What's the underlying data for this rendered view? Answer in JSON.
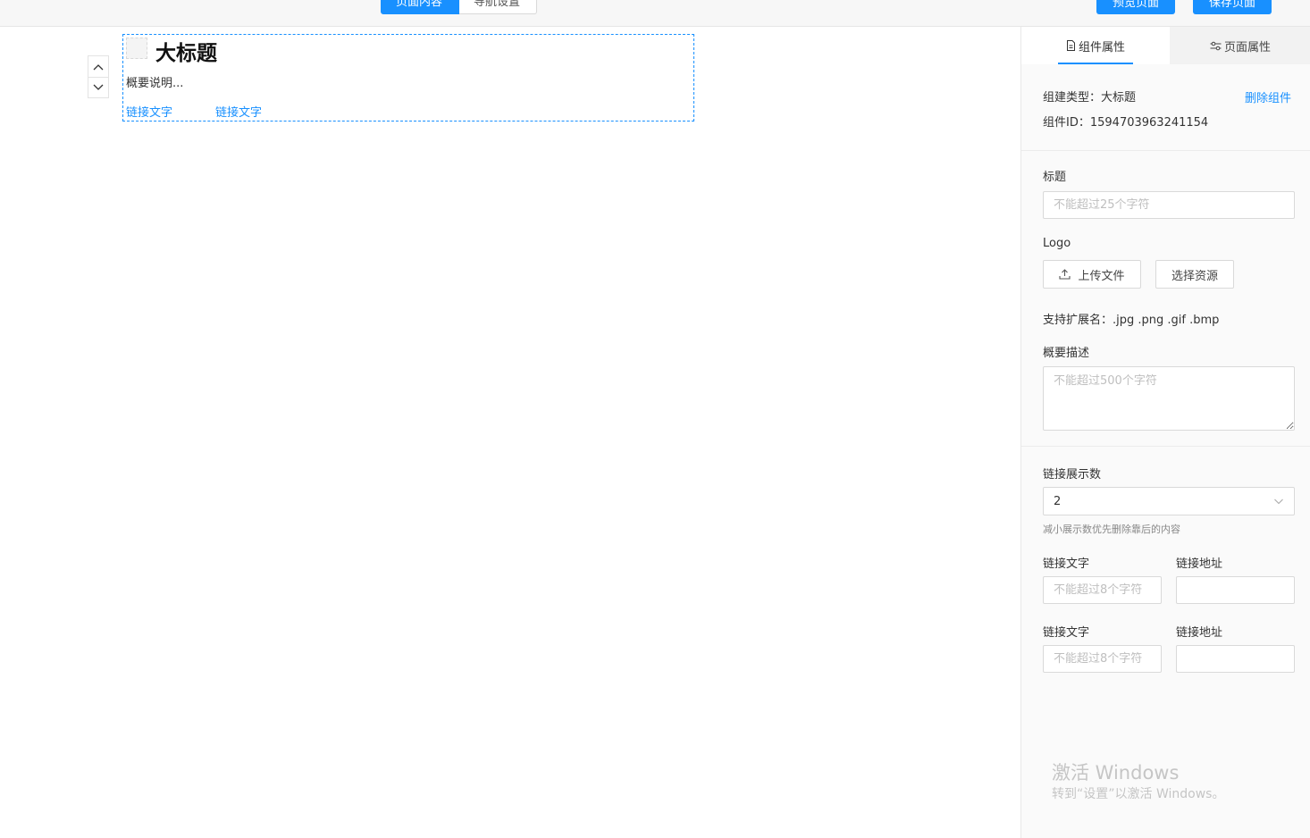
{
  "toolbar": {
    "tab_page_content": "页面内容",
    "tab_nav_settings": "导航设置",
    "preview_label": "预览页面",
    "save_label": "保存页面"
  },
  "canvas": {
    "component": {
      "title": "大标题",
      "summary": "概要说明...",
      "links": [
        "链接文字",
        "链接文字"
      ]
    }
  },
  "panel": {
    "tabs": [
      {
        "label": "组件属性",
        "icon": "document-icon",
        "active": true
      },
      {
        "label": "页面属性",
        "icon": "sliders-icon",
        "active": false
      }
    ],
    "info": {
      "type_label": "组建类型：",
      "type_value": "大标题",
      "id_label": "组件ID：",
      "id_value": "1594703963241154",
      "delete_label": "删除组件"
    },
    "title_field": {
      "label": "标题",
      "placeholder": "不能超过25个字符",
      "value": ""
    },
    "logo": {
      "label": "Logo",
      "upload_label": "上传文件",
      "select_label": "选择资源",
      "ext_label": "支持扩展名：",
      "ext_value": ".jpg .png .gif .bmp"
    },
    "desc_field": {
      "label": "概要描述",
      "placeholder": "不能超过500个字符",
      "value": ""
    },
    "link_count": {
      "label": "链接展示数",
      "value": "2",
      "hint": "减小展示数优先删除靠后的内容"
    },
    "link_rows": [
      {
        "text_label": "链接文字",
        "text_placeholder": "不能超过8个字符",
        "url_label": "链接地址"
      },
      {
        "text_label": "链接文字",
        "text_placeholder": "不能超过8个字符",
        "url_label": "链接地址"
      }
    ]
  },
  "watermark": {
    "title": "激活 Windows",
    "subtitle": "转到“设置”以激活 Windows。"
  },
  "colors": {
    "accent": "#1890ff",
    "border": "#d9d9d9",
    "placeholder": "#bfbfbf"
  }
}
